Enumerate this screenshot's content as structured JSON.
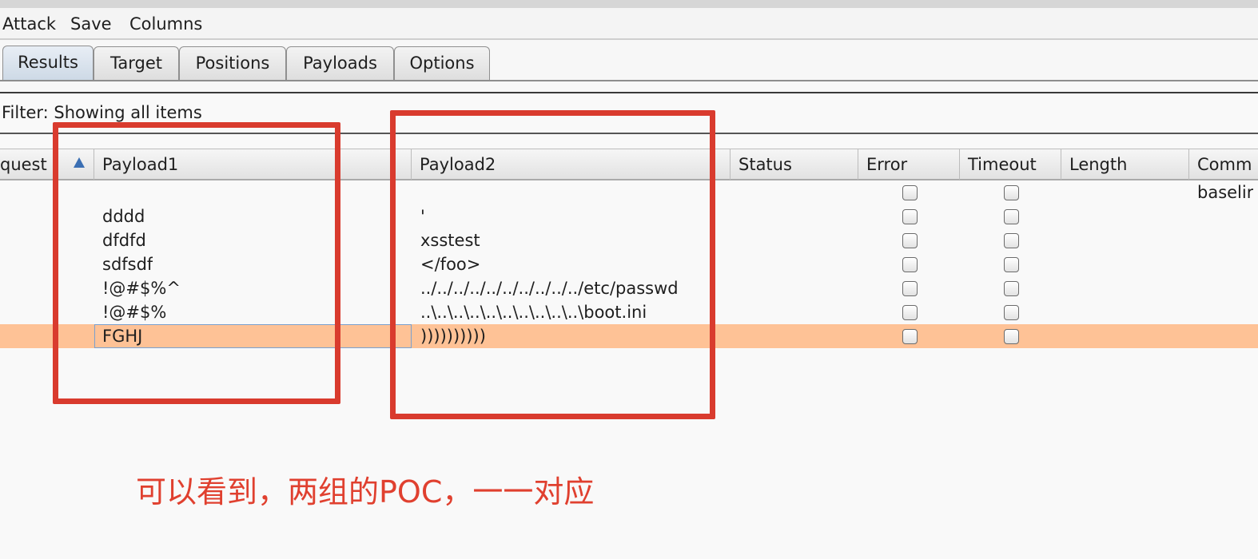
{
  "menu": [
    "Attack",
    "Save",
    "Columns"
  ],
  "tabs": [
    "Results",
    "Target",
    "Positions",
    "Payloads",
    "Options"
  ],
  "active_tab": "Results",
  "filter_text": "Filter: Showing all items",
  "columns": [
    "quest",
    "Payload1",
    "Payload2",
    "Status",
    "Error",
    "Timeout",
    "Length",
    "Comm"
  ],
  "rows": [
    {
      "payload1": "",
      "payload2": "",
      "comment": "baselir"
    },
    {
      "payload1": "dddd",
      "payload2": "'",
      "comment": ""
    },
    {
      "payload1": "dfdfd",
      "payload2": "xsstest",
      "comment": ""
    },
    {
      "payload1": "sdfsdf",
      "payload2": "</foo>",
      "comment": ""
    },
    {
      "payload1": "!@#$%^",
      "payload2": "../../../../../../../../../../etc/passwd",
      "comment": ""
    },
    {
      "payload1": "!@#$%",
      "payload2": "..\\..\\..\\..\\..\\..\\..\\..\\..\\..\\boot.ini",
      "comment": ""
    },
    {
      "payload1": "FGHJ",
      "payload2": "))))))))))",
      "comment": ""
    }
  ],
  "selected_row": 6,
  "annotation": "可以看到，两组的POC，一一对应",
  "colors": {
    "selected_row": "#fec296",
    "annotation": "#d93b2e",
    "sort_icon": "#3b6fb3"
  }
}
